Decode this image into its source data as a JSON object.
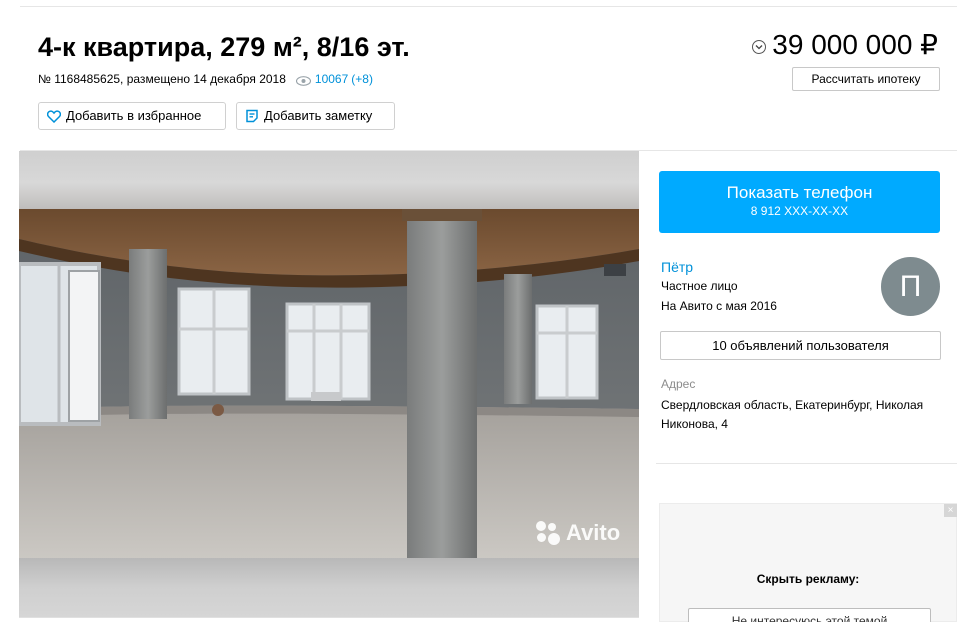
{
  "listing": {
    "title": "4-к квартира, 279 м², 8/16 эт.",
    "meta": "№ 1168485625, размещено 14 декабря 2018",
    "views": "10067",
    "views_delta": "(+8)",
    "price": "39 000 000 ₽",
    "mortgage_label": "Рассчитать ипотеку"
  },
  "actions": {
    "favorite_label": "Добавить в избранное",
    "note_label": "Добавить заметку"
  },
  "gallery": {
    "watermark": "Avito"
  },
  "contact": {
    "phone_button_label": "Показать телефон",
    "phone_masked": "8 912 XXX-XX-XX"
  },
  "seller": {
    "name": "Пётр",
    "type": "Частное лицо",
    "since": "На Авито с мая 2016",
    "avatar_letter": "П",
    "ads_button_label": "10 объявлений пользователя"
  },
  "address": {
    "label": "Адрес",
    "value": "Свердловская область, Екатеринбург, Николая Никонова, 4"
  },
  "ad": {
    "hide_label": "Скрыть рекламу:",
    "reason_label": "Не интересуюсь этой темой",
    "close_glyph": "×"
  },
  "colors": {
    "accent": "#00aaff",
    "link": "#0091d9",
    "avatar_bg": "#7e8b8f"
  },
  "icons": [
    "heart-icon",
    "note-icon",
    "eye-icon",
    "chevron-down-icon",
    "close-icon"
  ]
}
